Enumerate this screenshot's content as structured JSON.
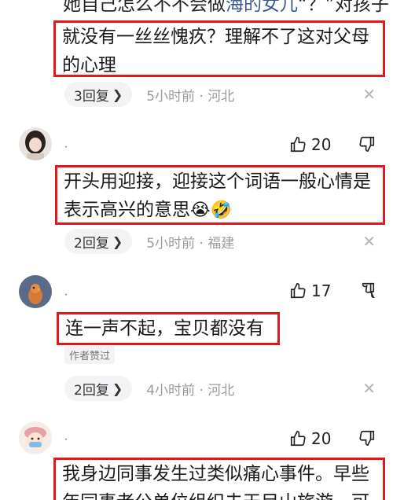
{
  "comment1": {
    "cut_text": "她自己怎么不不会做",
    "cut_link": "海的女儿",
    "cut_rest": "“？”对孩子",
    "text": "就没有一丝丝愧疚？理解不了这对父母的心理",
    "text_line1": "就没有一丝丝愧疚？理解不了这对父母",
    "text_line2": "的心理",
    "replies": "3回复",
    "meta": "5小时前 · 河北"
  },
  "comment2": {
    "username": "·",
    "likes": "20",
    "text_line1": "开头用迎接，迎接这个词语一般心情是",
    "text_line2": "表示高兴的意思",
    "emoji1": "😭",
    "emoji2": "🤣",
    "replies": "2回复",
    "meta": "5小时前 · 福建"
  },
  "comment3": {
    "username": "·",
    "likes": "17",
    "text": "连一声不起，宝贝都没有",
    "author_tag": "作者赞过",
    "replies": "2回复",
    "meta": "4小时前 · 河北"
  },
  "comment4": {
    "username": "·",
    "likes": "20",
    "text_line1": "我身边同事发生过类似痛心事件。早些",
    "text_line2": "年同事老公单位组织去天目山旅游，可"
  },
  "icons": {
    "like": "thumbs-up-icon",
    "dislike": "thumbs-down-icon",
    "close": "close-icon",
    "chevron": "chevron-right-icon"
  },
  "colors": {
    "highlight_border": "#e01a1a",
    "meta_gray": "#9a9a9a",
    "pill_bg": "#f2f3f5"
  }
}
